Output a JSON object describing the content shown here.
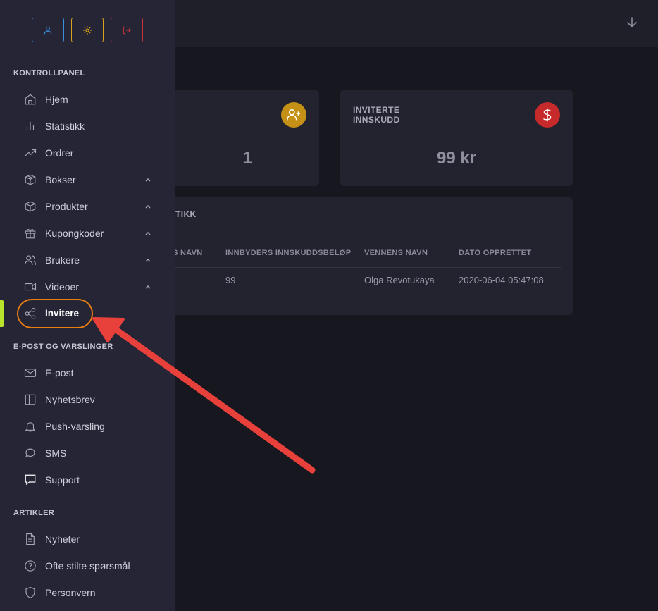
{
  "colors": {
    "accent": "#b8e52c",
    "highlight": "#e97d12",
    "arrow": "#e8413c",
    "sidebar_bg": "#252536",
    "main_bg": "#17171f"
  },
  "toolbar": {
    "user_icon": "user-icon",
    "settings_icon": "gear-icon",
    "logout_icon": "logout-icon"
  },
  "topbar": {
    "icon": "arrow-down-icon"
  },
  "sidebar": {
    "sections": [
      {
        "title": "KONTROLLPANEL"
      },
      {
        "title": "E-POST OG VARSLINGER"
      },
      {
        "title": "ARTIKLER"
      }
    ],
    "items": [
      {
        "label": "Hjem",
        "icon": "home-icon"
      },
      {
        "label": "Statistikk",
        "icon": "bar-chart-icon"
      },
      {
        "label": "Ordrer",
        "icon": "trending-up-icon"
      },
      {
        "label": "Bokser",
        "icon": "box-icon",
        "expandable": true
      },
      {
        "label": "Produkter",
        "icon": "cube-icon",
        "expandable": true
      },
      {
        "label": "Kupongkoder",
        "icon": "gift-icon",
        "expandable": true
      },
      {
        "label": "Brukere",
        "icon": "users-icon",
        "expandable": true
      },
      {
        "label": "Videoer",
        "icon": "video-icon",
        "expandable": true
      },
      {
        "label": "Invitere",
        "icon": "share-icon",
        "active": true
      },
      {
        "label": "E-post",
        "icon": "mail-icon"
      },
      {
        "label": "Nyhetsbrev",
        "icon": "newsletter-icon"
      },
      {
        "label": "Push-varsling",
        "icon": "bell-icon"
      },
      {
        "label": "SMS",
        "icon": "message-icon"
      },
      {
        "label": "Support",
        "icon": "support-icon"
      },
      {
        "label": "Nyheter",
        "icon": "file-text-icon"
      },
      {
        "label": "Ofte stilte spørsmål",
        "icon": "help-circle-icon"
      },
      {
        "label": "Personvern",
        "icon": "shield-icon"
      }
    ]
  },
  "cards": [
    {
      "label": "",
      "value": "1",
      "icon": "user-plus-icon",
      "color": "#c49116"
    },
    {
      "label": "INVITERTE\nINNSKUDD",
      "value": "99 kr",
      "icon": "dollar-icon",
      "color": "#c62a2a"
    }
  ],
  "stats": {
    "title": "TIKK",
    "columns": [
      "S NAVN",
      "INNBYDERS INNSKUDDSBELØP",
      "VENNENS NAVN",
      "DATO OPPRETTET"
    ],
    "rows": [
      [
        "",
        "99",
        "Olga Revotukaya",
        "2020-06-04 05:47:08"
      ]
    ]
  }
}
